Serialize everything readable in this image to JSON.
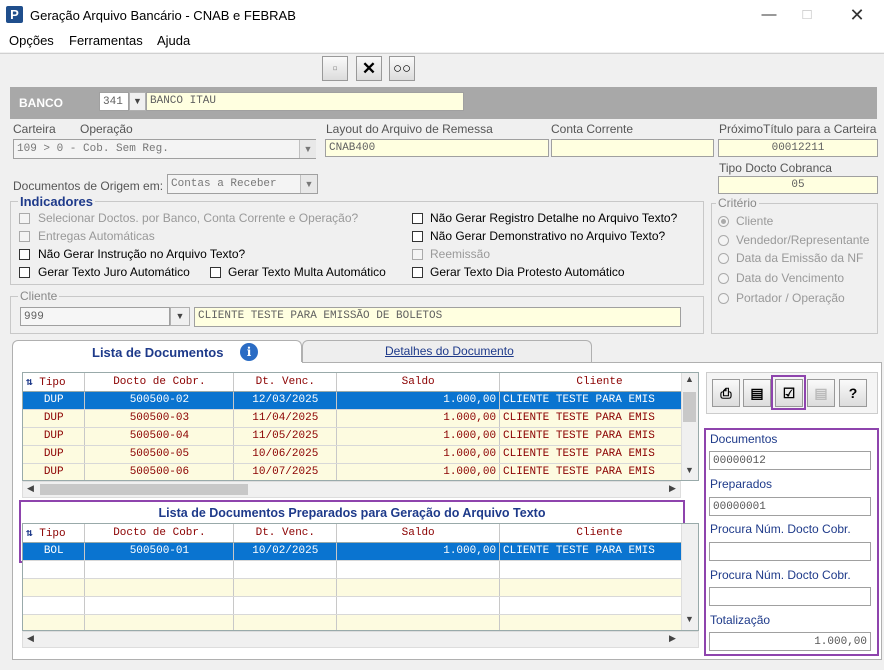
{
  "window": {
    "title": "Geração Arquivo Bancário - CNAB e FEBRAB",
    "app_icon": "P"
  },
  "menu": [
    "Opções",
    "Ferramentas",
    "Ajuda"
  ],
  "banco": {
    "label": "BANCO",
    "code": "341",
    "name": "BANCO ITAU"
  },
  "labels": {
    "carteira": "Carteira",
    "operacao": "Operação",
    "layout": "Layout do Arquivo de Remessa",
    "conta": "Conta Corrente",
    "proximo": "PróximoTítulo para a Carteira",
    "tipo_docto": "Tipo Docto Cobranca",
    "docs_origem": "Documentos de Origem em:",
    "indicadores": "Indicadores",
    "criterio": "Critério",
    "cliente": "Cliente"
  },
  "fields": {
    "carteira_operacao": "109   > 0 - Cob. Sem Reg.",
    "layout": "CNAB400",
    "conta": "",
    "proximo_titulo": "00012211",
    "tipo_docto": "05",
    "docs_origem": "Contas a Receber",
    "cliente_code": "999",
    "cliente_name": "CLIENTE TESTE PARA EMISSÃO DE BOLETOS"
  },
  "indicadores": {
    "selecionar": "Selecionar Doctos. por Banco, Conta Corrente  e Operação?",
    "entregas": "Entregas Automáticas",
    "nao_instrucao": "Não Gerar Instrução no Arquivo Texto?",
    "texto_juro": "Gerar Texto Juro Automático",
    "texto_multa": "Gerar Texto Multa Automático",
    "nao_registro": "Não Gerar Registro Detalhe no Arquivo Texto?",
    "nao_demonstrativo": "Não Gerar Demonstrativo no Arquivo Texto?",
    "reemissao": "Reemissão",
    "texto_protesto": "Gerar Texto Dia Protesto Automático"
  },
  "criterio": [
    "Cliente",
    "Vendedor/Representante",
    "Data da Emissão da NF",
    "Data do Vencimento",
    "Portador / Operação"
  ],
  "tabs": {
    "lista": "Lista de Documentos",
    "detalhes": "Detalhes do Documento"
  },
  "columns": [
    "Tipo",
    "Docto de Cobr.",
    "Dt. Venc.",
    "Saldo",
    "Cliente"
  ],
  "documentos": [
    [
      "DUP",
      "500500-02",
      "12/03/2025",
      "1.000,00",
      "CLIENTE TESTE PARA EMIS"
    ],
    [
      "DUP",
      "500500-03",
      "11/04/2025",
      "1.000,00",
      "CLIENTE TESTE PARA EMIS"
    ],
    [
      "DUP",
      "500500-04",
      "11/05/2025",
      "1.000,00",
      "CLIENTE TESTE PARA EMIS"
    ],
    [
      "DUP",
      "500500-05",
      "10/06/2025",
      "1.000,00",
      "CLIENTE TESTE PARA EMIS"
    ],
    [
      "DUP",
      "500500-06",
      "10/07/2025",
      "1.000,00",
      "CLIENTE TESTE PARA EMIS"
    ]
  ],
  "preparados_title": "Lista de Documentos Preparados para Geração do Arquivo Texto",
  "preparados": [
    [
      "BOL",
      "500500-01",
      "10/02/2025",
      "1.000,00",
      "CLIENTE TESTE PARA EMIS"
    ]
  ],
  "side": {
    "documentos_label": "Documentos",
    "documentos_value": "00000012",
    "preparados_label": "Preparados",
    "preparados_value": "00000001",
    "procura1_label": "Procura Núm. Docto Cobr.",
    "procura1_value": "",
    "procura2_label": "Procura Núm. Docto Cobr.",
    "procura2_value": "",
    "totalizacao_label": "Totalização",
    "totalizacao_value": "1.000,00"
  },
  "colors": {
    "accent_purple": "#8e44ad",
    "selection_blue": "#0a74d0",
    "header_red": "#8b0000"
  }
}
